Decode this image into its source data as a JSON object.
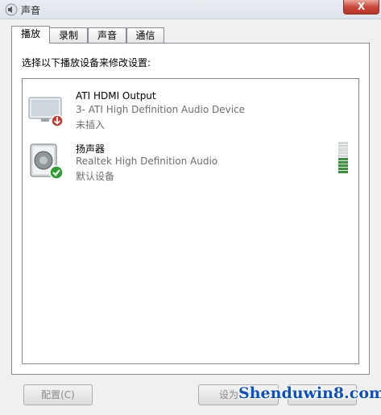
{
  "window": {
    "title": "声音",
    "close_label": "X"
  },
  "tabs": [
    {
      "label": "播放",
      "active": true
    },
    {
      "label": "录制",
      "active": false
    },
    {
      "label": "声音",
      "active": false
    },
    {
      "label": "通信",
      "active": false
    }
  ],
  "instruction": "选择以下播放设备来修改设置:",
  "devices": [
    {
      "name": "ATI HDMI Output",
      "description": "3- ATI High Definition Audio Device",
      "status": "未插入",
      "icon": "monitor-icon",
      "badge": "red-down-arrow-badge"
    },
    {
      "name": "扬声器",
      "description": "Realtek High Definition Audio",
      "status": "默认设备",
      "icon": "speaker-icon",
      "badge": "green-check-badge",
      "meter_level": 0.5
    }
  ],
  "buttons": {
    "configure": "配置(C)",
    "set_default": "设为默认"
  },
  "watermark": "Shenduwin8.com",
  "colors": {
    "accent_green": "#3ea33e",
    "badge_red": "#c0392b",
    "watermark_blue": "#0a4fc4"
  }
}
